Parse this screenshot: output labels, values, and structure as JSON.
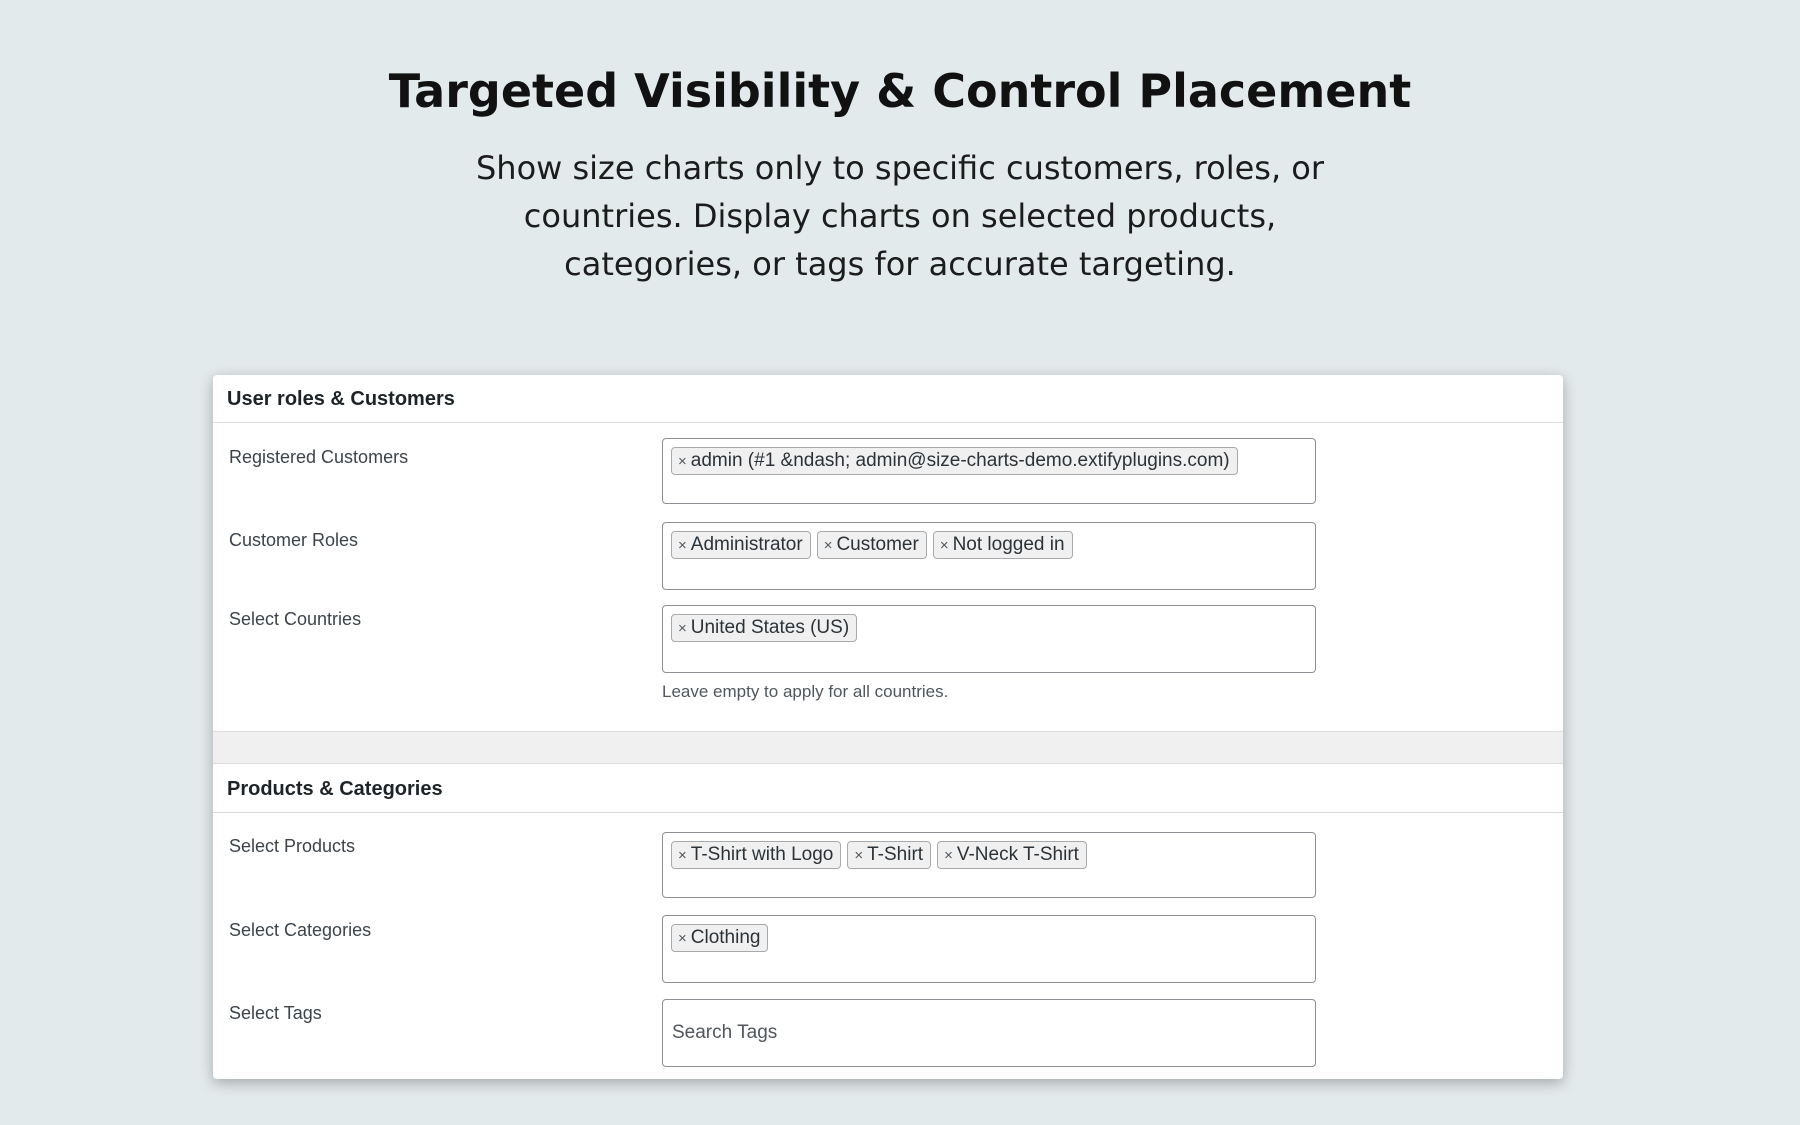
{
  "hero": {
    "title": "Targeted Visibility & Control Placement",
    "description": "Show size charts only to specific customers, roles, or countries. Display charts on selected products, categories, or tags for accurate targeting."
  },
  "users_section": {
    "title": "User roles & Customers",
    "registered_customers": {
      "label": "Registered Customers",
      "chips": [
        "admin (#1 &ndash; admin@size-charts-demo.extifyplugins.com)"
      ]
    },
    "customer_roles": {
      "label": "Customer Roles",
      "chips": [
        "Administrator",
        "Customer",
        "Not logged in"
      ]
    },
    "countries": {
      "label": "Select Countries",
      "chips": [
        "United States (US)"
      ],
      "hint": "Leave empty to apply for all countries."
    }
  },
  "products_section": {
    "title": "Products & Categories",
    "products": {
      "label": "Select Products",
      "chips": [
        "T-Shirt with Logo",
        "T-Shirt",
        "V-Neck T-Shirt"
      ]
    },
    "categories": {
      "label": "Select Categories",
      "chips": [
        "Clothing"
      ]
    },
    "tags": {
      "label": "Select Tags",
      "placeholder": "Search Tags"
    }
  },
  "chip_remove_glyph": "×",
  "icons": {
    "chip_remove": "close-icon"
  }
}
